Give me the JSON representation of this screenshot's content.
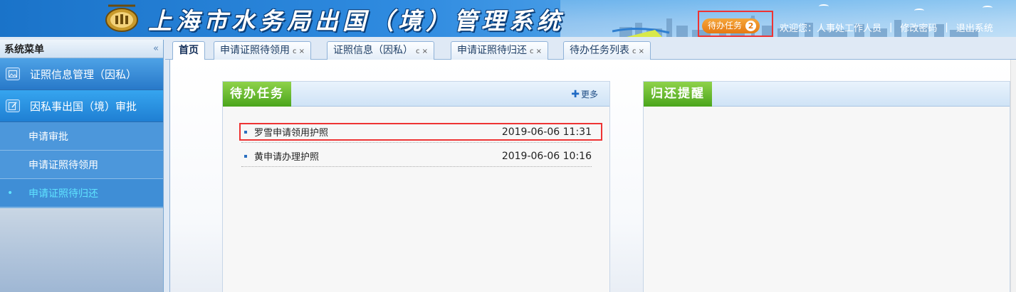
{
  "header": {
    "title": "上海市水务局出国（境）管理系统",
    "todo_label": "待办任务",
    "todo_count": "2",
    "welcome": "欢迎您：人事处工作人员",
    "change_password": "修改密码",
    "logout": "退出系统",
    "separator": "|"
  },
  "sidebar": {
    "title": "系统菜单",
    "collapse_glyph": "«",
    "groups": [
      {
        "label": "证照信息管理（因私）",
        "icon": "image-icon"
      },
      {
        "label": "因私事出国（境）审批",
        "icon": "edit-icon"
      }
    ],
    "items": [
      {
        "label": "申请审批"
      },
      {
        "label": "申请证照待领用"
      },
      {
        "label": "申请证照待归还",
        "current": true
      }
    ]
  },
  "tabs": [
    {
      "label": "首页",
      "active": true
    },
    {
      "label": "申请证照待领用",
      "controls": "ᴄ ×"
    },
    {
      "label": "证照信息（因私）",
      "controls": "ᴄ ×"
    },
    {
      "label": "申请证照待归还",
      "controls": "ᴄ ×"
    },
    {
      "label": "待办任务列表",
      "controls": "ᴄ ×"
    }
  ],
  "panels": {
    "todo": {
      "title": "待办任务",
      "more": "更多",
      "items": [
        {
          "text": "罗雪申请领用护照",
          "date": "2019-06-06 11:31"
        },
        {
          "text": "黄申请办理护照",
          "date": "2019-06-06 10:16"
        }
      ]
    },
    "return_reminder": {
      "title": "归还提醒"
    }
  },
  "colors": {
    "header_blue": "#2f8be0",
    "panel_title_green": "#4aa51c",
    "todo_orange": "#e57a12",
    "highlight_red": "#ee3333",
    "current_item_cyan": "#5fe3ff"
  }
}
